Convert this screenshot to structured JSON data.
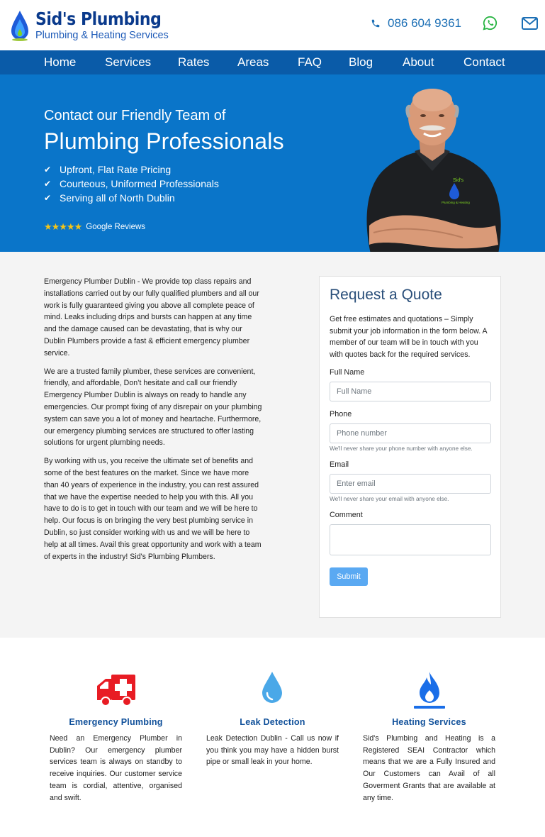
{
  "brand": {
    "name": "Sid's Plumbing",
    "tagline": "Plumbing & Heating Services"
  },
  "header": {
    "phone": "086 604 9361",
    "icons": [
      "phone-icon",
      "whatsapp-icon",
      "mail-icon"
    ]
  },
  "nav": {
    "items": [
      "Home",
      "Services",
      "Rates",
      "Areas",
      "FAQ",
      "Blog",
      "About",
      "Contact"
    ]
  },
  "hero": {
    "subtitle": "Contact our Friendly Team of",
    "title": "Plumbing Professionals",
    "bullets": [
      "Upfront, Flat Rate Pricing",
      "Courteous, Uniformed Professionals",
      "Serving all of North Dublin"
    ],
    "stars": "★★★★★",
    "reviews_label": "Google Reviews",
    "shirt_badge": "Sid's",
    "shirt_text": "Plumbing & Heating"
  },
  "content": {
    "paragraphs": [
      "Emergency Plumber Dublin - We provide top class repairs and installations carried out by our fully qualified plumbers and all our work is fully guaranteed giving you above all complete peace of mind. Leaks including drips and bursts can happen at any time and the damage caused can be devastating, that is why our Dublin Plumbers provide a fast & efficient emergency plumber service.",
      "We are a trusted family plumber, these services are convenient, friendly, and affordable, Don’t hesitate and call our friendly Emergency Plumber Dublin is always on ready to handle any emergencies. Our prompt fixing of any disrepair on your plumbing system can save you a lot of money and heartache. Furthermore, our emergency plumbing services are structured to offer lasting solutions for urgent plumbing needs.",
      "By working with us, you receive the ultimate set of benefits and some of the best features on the market. Since we have more than 40 years of experience in the industry, you can rest assured that we have the expertise needed to help you with this. All you have to do is to get in touch with our team and we will be here to help. Our focus is on bringing the very best plumbing service in Dublin, so just consider working with us and we will be here to help at all times. Avail this great opportunity and work with a team of experts in the industry! Sid's Plumbing Plumbers."
    ]
  },
  "quote_form": {
    "title": "Request a Quote",
    "intro": "Get free estimates and quotations – Simply submit your job information in the form below. A member of our team will be in touch with you with quotes back for the required services.",
    "full_name_label": "Full Name",
    "full_name_placeholder": "Full Name",
    "phone_label": "Phone",
    "phone_placeholder": "Phone number",
    "phone_help": "We'll never share your phone number with anyone else.",
    "email_label": "Email",
    "email_placeholder": "Enter email",
    "email_help": "We'll never share your email with anyone else.",
    "comment_label": "Comment",
    "submit_label": "Submit"
  },
  "services": [
    {
      "icon": "ambulance-icon",
      "title": "Emergency Plumbing",
      "text": "Need an Emergency Plumber in Dublin? Our emergency plumber services team is always on standby to receive inquiries. Our customer service team is cordial, attentive, organised and swift."
    },
    {
      "icon": "water-drop-icon",
      "title": "Leak Detection",
      "text": "Leak Detection Dublin - Call us now if you think you may have a hidden burst pipe or small leak in your home."
    },
    {
      "icon": "gas-flame-icon",
      "title": "Heating Services",
      "text": "Sid's Plumbing and Heating is a Registered SEAI Contractor which means that we are a Fully Insured and Our Customers can Avail of all Goverment Grants that are available at any time."
    }
  ],
  "colors": {
    "brand_navy": "#0a3a8c",
    "nav_blue": "#0a5ba8",
    "hero_blue": "#0a75c9",
    "accent_red": "#e81c24",
    "drop_blue": "#4aa8e8",
    "flame_blue": "#1a6ee8",
    "star_gold": "#f5c518",
    "whatsapp_green": "#25b340"
  }
}
